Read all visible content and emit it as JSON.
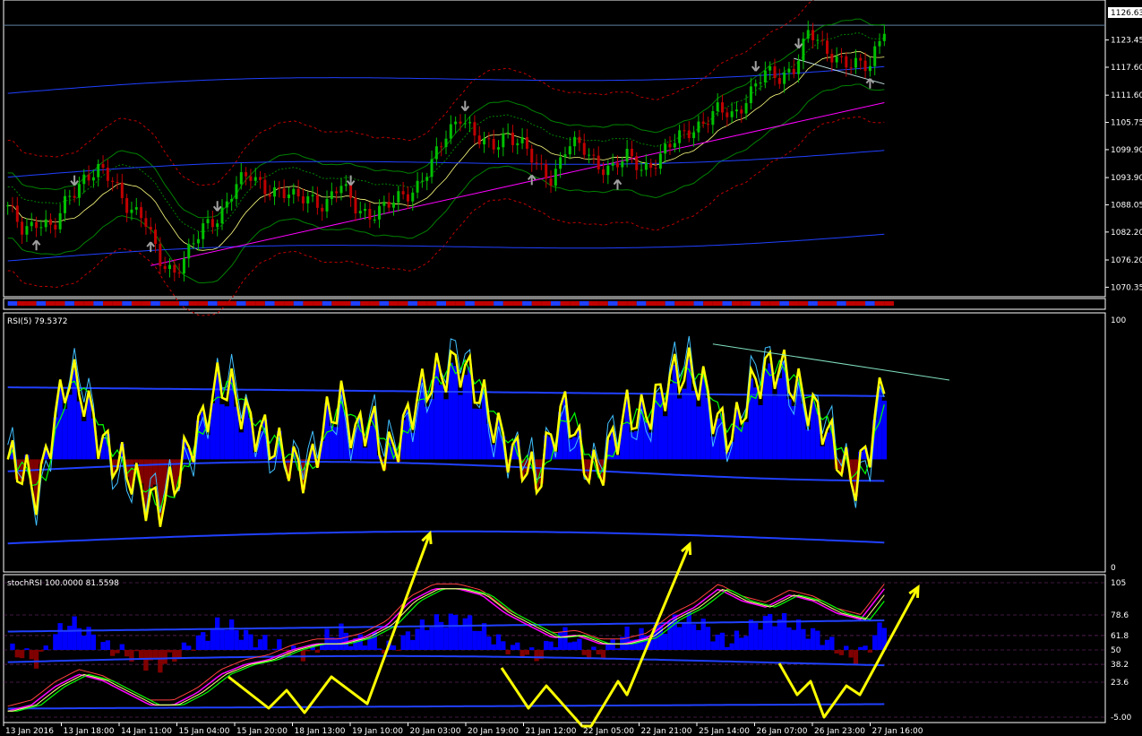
{
  "colors": {
    "background": "#000000",
    "grid_line": "#ffffff",
    "candle_up": "#00c000",
    "candle_down": "#c00000",
    "rsi_line": "#ffff00",
    "hist_pos": "#0000ff",
    "hist_neg": "#800000",
    "trend_line": "#ff00ff",
    "band_blue": "#2040ff",
    "band_red": "#c00000",
    "band_green": "#008000",
    "arrow": "#ffff00",
    "cyan": "#40c0ff"
  },
  "price_panel": {
    "current_price_label": "1126.63",
    "icons": [
      "up-arrow-marker-icon",
      "down-arrow-marker-icon"
    ]
  },
  "rsi_panel": {
    "title": "RSI(5) 79.5372",
    "scale_top": "100",
    "scale_bottom": "0"
  },
  "stoch_panel": {
    "title": "stochRSI 100.0000 81.5598",
    "scale_top": "105",
    "scale_bottom": "-5.00"
  },
  "chart_data": [
    {
      "type": "candlestick",
      "panel": "price",
      "y_ticks": [
        "1123.45",
        "1117.60",
        "1111.60",
        "1105.75",
        "1099.90",
        "1093.90",
        "1088.05",
        "1082.20",
        "1076.20",
        "1070.35"
      ],
      "ylim": [
        1068.5,
        1130.5
      ],
      "current_price": 1126.63,
      "x_ticks": [
        "13 Jan 2016",
        "13 Jan 18:00",
        "14 Jan 11:00",
        "15 Jan 04:00",
        "15 Jan 20:00",
        "18 Jan 13:00",
        "19 Jan 10:00",
        "20 Jan 03:00",
        "20 Jan 19:00",
        "21 Jan 12:00",
        "22 Jan 05:00",
        "22 Jan 21:00",
        "25 Jan 14:00",
        "26 Jan 07:00",
        "26 Jan 23:00",
        "27 Jan 16:00"
      ],
      "close_path": [
        1087,
        1083,
        1085,
        1082,
        1090,
        1094,
        1095,
        1093,
        1088,
        1085,
        1076,
        1074,
        1078,
        1083,
        1086,
        1092,
        1094,
        1092,
        1091,
        1089,
        1090,
        1088,
        1092,
        1088,
        1086,
        1087,
        1090,
        1092,
        1096,
        1103,
        1108,
        1102,
        1100,
        1104,
        1101,
        1096,
        1094,
        1101,
        1100,
        1097,
        1096,
        1098,
        1096,
        1098,
        1101,
        1104,
        1106,
        1108,
        1107,
        1112,
        1116,
        1115,
        1118,
        1125,
        1121,
        1120,
        1118,
        1117,
        1127
      ],
      "title": "",
      "xlabel": "",
      "ylabel": ""
    },
    {
      "type": "line",
      "panel": "rsi",
      "title": "RSI(5) 79.5372",
      "ylim": [
        0,
        100
      ],
      "y_ticks": [
        "100",
        "0"
      ],
      "series": [
        {
          "name": "RSI(5)",
          "values": [
            45,
            40,
            30,
            60,
            80,
            72,
            55,
            45,
            40,
            30,
            25,
            35,
            50,
            62,
            78,
            72,
            60,
            55,
            48,
            42,
            40,
            60,
            70,
            55,
            62,
            45,
            55,
            70,
            78,
            82,
            85,
            75,
            62,
            50,
            45,
            35,
            55,
            68,
            45,
            38,
            52,
            65,
            62,
            70,
            80,
            82,
            76,
            60,
            55,
            72,
            82,
            84,
            76,
            68,
            60,
            45,
            35,
            50,
            80
          ]
        }
      ]
    },
    {
      "type": "line",
      "panel": "stochRSI",
      "title": "stochRSI 100.0000 81.5598",
      "ylim": [
        -5,
        105
      ],
      "y_ticks": [
        "105",
        "78.6",
        "61.8",
        "50",
        "38.2",
        "23.6",
        "-5.00"
      ],
      "series": [
        {
          "name": "stochRSI",
          "values": [
            0,
            5,
            20,
            30,
            25,
            15,
            5,
            5,
            15,
            30,
            38,
            42,
            50,
            55,
            55,
            60,
            70,
            90,
            100,
            100,
            95,
            80,
            70,
            60,
            62,
            55,
            55,
            60,
            75,
            85,
            100,
            90,
            85,
            95,
            90,
            80,
            75,
            100
          ]
        }
      ]
    }
  ]
}
